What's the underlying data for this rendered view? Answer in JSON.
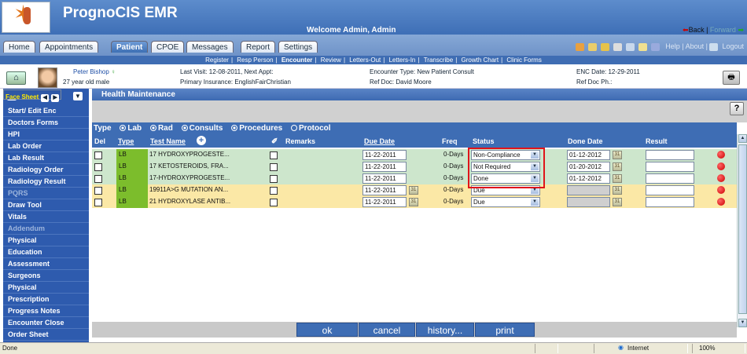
{
  "app": {
    "title": "PrognoCIS EMR",
    "welcome": "Welcome Admin, Admin",
    "back_label": "Back",
    "forward_label": "Forward"
  },
  "tabs": [
    "Home",
    "Appointments",
    "Patient",
    "CPOE",
    "Messages",
    "Report",
    "Settings"
  ],
  "active_tab": "Patient",
  "right_links": {
    "help": "Help",
    "about": "About",
    "logout": "Logout"
  },
  "subnav": [
    "Register",
    "Resp Person",
    "Encounter",
    "Review",
    "Letters-Out",
    "Letters-In",
    "Transcribe",
    "Growth Chart",
    "Clinic Forms"
  ],
  "patient": {
    "name": "Peter Bishop",
    "age_sex": "27 year old male",
    "last_visit": "Last Visit: 12-08-2011, Next Appt:",
    "insurance": "Primary Insurance: EnglishFairChristian",
    "encounter_type": "Encounter Type: New Patient Consult",
    "ref_doc": "Ref Doc: David Moore",
    "enc_date": "ENC Date: 12-29-2011",
    "ref_doc_ph": "Ref Doc Ph.:"
  },
  "sidebar": {
    "items": [
      {
        "label": "Start/ Edit Enc",
        "state": "normal"
      },
      {
        "label": "Doctors Forms",
        "state": "normal"
      },
      {
        "label": "Face Sheet",
        "state": "selected"
      },
      {
        "label": "HPI",
        "state": "normal"
      },
      {
        "label": "Lab Order",
        "state": "normal"
      },
      {
        "label": "Lab Result",
        "state": "normal"
      },
      {
        "label": "Radiology Order",
        "state": "normal"
      },
      {
        "label": "Radiology Result",
        "state": "normal"
      },
      {
        "label": "PQRS",
        "state": "dim"
      },
      {
        "label": "Draw Tool",
        "state": "normal"
      },
      {
        "label": "Vitals",
        "state": "normal"
      },
      {
        "label": "Addendum",
        "state": "dim"
      },
      {
        "label": "Physical",
        "state": "normal"
      },
      {
        "label": "Education",
        "state": "normal"
      },
      {
        "label": "Assessment",
        "state": "normal"
      },
      {
        "label": "Surgeons",
        "state": "normal"
      },
      {
        "label": "Physical",
        "state": "normal"
      },
      {
        "label": "Prescription",
        "state": "normal"
      },
      {
        "label": "Progress Notes",
        "state": "normal"
      },
      {
        "label": "Encounter Close",
        "state": "normal"
      },
      {
        "label": "Order Sheet",
        "state": "normal"
      }
    ]
  },
  "main": {
    "section_title": "Health Maintenance",
    "help_label": "?",
    "type_label": "Type",
    "type_options": [
      "Lab",
      "Rad",
      "Consults",
      "Procedures",
      "Protocol"
    ],
    "type_selected": "Lab",
    "columns": {
      "del": "Del",
      "type": "Type",
      "test_name": "Test Name",
      "remarks": "Remarks",
      "due_date": "Due Date",
      "freq": "Freq",
      "status": "Status",
      "done_date": "Done Date",
      "result": "Result"
    },
    "rows": [
      {
        "type": "LB",
        "test": "17 HYDROXYPROGESTE...",
        "due": "11-22-2011",
        "freq": "0-Days",
        "status": "Non-Compliance",
        "done": "01-12-2012",
        "result": "",
        "color": "green",
        "cal_due": false,
        "done_enabled": true
      },
      {
        "type": "LB",
        "test": "17 KETOSTEROIDS, FRA...",
        "due": "11-22-2011",
        "freq": "0-Days",
        "status": "Not Required",
        "done": "01-20-2012",
        "result": "",
        "color": "green",
        "cal_due": false,
        "done_enabled": true
      },
      {
        "type": "LB",
        "test": "17-HYDROXYPROGESTE...",
        "due": "11-22-2011",
        "freq": "0-Days",
        "status": "Done",
        "done": "01-12-2012",
        "result": "",
        "color": "green",
        "cal_due": false,
        "done_enabled": true
      },
      {
        "type": "LB",
        "test": "19911A>G MUTATION AN...",
        "due": "11-22-2011",
        "freq": "0-Days",
        "status": "Due",
        "done": "",
        "result": "",
        "color": "yellow",
        "cal_due": true,
        "done_enabled": false
      },
      {
        "type": "LB",
        "test": "21 HYDROXYLASE ANTIB...",
        "due": "11-22-2011",
        "freq": "0-Days",
        "status": "Due",
        "done": "",
        "result": "",
        "color": "yellow",
        "cal_due": true,
        "done_enabled": false
      }
    ],
    "buttons": {
      "ok": "ok",
      "cancel": "cancel",
      "history": "history...",
      "print": "print"
    }
  },
  "statusbar": {
    "left": "Done",
    "zone": "Internet",
    "zoom": "100%"
  },
  "colors": {
    "header": "#3e6fb6",
    "green_row": "#cde6cc",
    "yellow_row": "#fbe8a6",
    "lab_badge": "#7cbd2c",
    "highlight": "#e0141a"
  }
}
